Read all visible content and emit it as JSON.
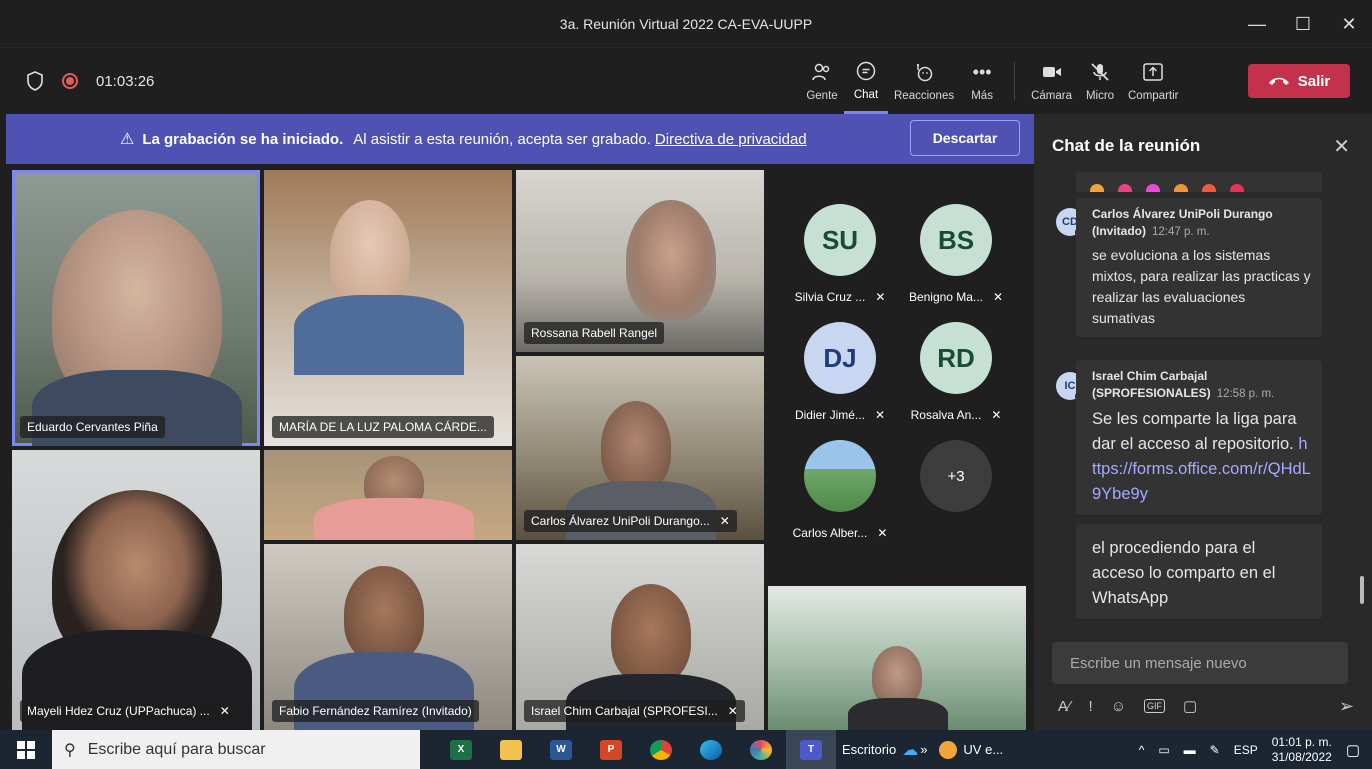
{
  "window": {
    "title": "3a. Reunión Virtual 2022 CA-EVA-UUPP",
    "minimize": "—",
    "maximize": "☐",
    "close": "✕"
  },
  "toolbar": {
    "timer": "01:03:26",
    "tools": [
      {
        "label": "Gente",
        "icon": "people-icon"
      },
      {
        "label": "Chat",
        "icon": "chat-icon",
        "active": true
      },
      {
        "label": "Reacciones",
        "icon": "reactions-icon"
      },
      {
        "label": "Más",
        "icon": "more-icon"
      }
    ],
    "devices": [
      {
        "label": "Cámara",
        "icon": "camera-icon"
      },
      {
        "label": "Micro",
        "icon": "mic-off-icon"
      },
      {
        "label": "Compartir",
        "icon": "share-icon"
      }
    ],
    "leave_label": "Salir"
  },
  "banner": {
    "bold": "La grabación se ha iniciado.",
    "text": "Al asistir a esta reunión, acepta ser grabado.",
    "link": "Directiva de privacidad",
    "dismiss": "Descartar"
  },
  "participants": [
    {
      "name": "Eduardo Cervantes Piña"
    },
    {
      "name": "MARÍA DE LA LUZ PALOMA CÁRDE..."
    },
    {
      "name": "Rossana Rabell Rangel"
    },
    {
      "name": "Carlos Álvarez UniPoli Durango..."
    },
    {
      "name": "Mayeli Hdez Cruz (UPPachuca) ..."
    },
    {
      "name": "Fabio Fernández Ramírez (Invitado)"
    },
    {
      "name": "Israel Chim Carbajal (SPROFESI..."
    }
  ],
  "avatars": [
    {
      "initials": "SU",
      "name": "Silvia Cruz ..."
    },
    {
      "initials": "BS",
      "name": "Benigno Ma..."
    },
    {
      "initials": "DJ",
      "name": "Didier Jimé..."
    },
    {
      "initials": "RD",
      "name": "Rosalva An..."
    },
    {
      "initials": "",
      "name": "Carlos Alber..."
    },
    {
      "initials": "+3",
      "name": ""
    }
  ],
  "chat": {
    "title": "Chat de la reunión",
    "messages": [
      {
        "initials": "CD",
        "author": "Carlos Álvarez UniPoli Durango (Invitado)",
        "time": "12:47 p. m.",
        "body": "se evoluciona a los sistemas mixtos, para realizar las practicas y realizar las evaluaciones sumativas"
      },
      {
        "initials": "IC",
        "author": "Israel Chim Carbajal (SPROFESIONALES)",
        "time": "12:58 p. m.",
        "body": "Se les comparte la liga para dar el acceso al repositorio.",
        "link": "https://forms.office.com/r/QHdL9Ybe9y"
      },
      {
        "body": "el procediendo para el acceso lo comparto en el WhatsApp"
      }
    ],
    "compose_placeholder": "Escribe un mensaje nuevo"
  },
  "taskbar": {
    "search_placeholder": "Escribe aquí para buscar",
    "desktop_label": "Escritorio",
    "uv_label": "UV e...",
    "lang": "ESP",
    "time": "01:01 p. m.",
    "date": "31/08/2022"
  }
}
